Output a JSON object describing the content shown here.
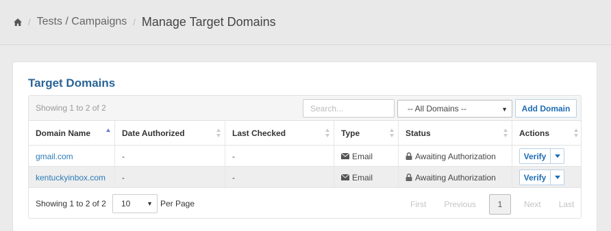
{
  "breadcrumb": {
    "home_icon": "home-icon",
    "items": [
      "Tests / Campaigns"
    ],
    "current": "Manage Target Domains"
  },
  "panel": {
    "title": "Target Domains"
  },
  "toolbar": {
    "info": "Showing 1 to 2 of 2",
    "search_placeholder": "Search...",
    "domain_filter": "-- All Domains --",
    "add_button": "Add Domain"
  },
  "table": {
    "columns": [
      "Domain Name",
      "Date Authorized",
      "Last Checked",
      "Type",
      "Status",
      "Actions"
    ],
    "sorted_column": "Domain Name",
    "rows": [
      {
        "domain": "gmail.com",
        "date_authorized": "-",
        "last_checked": "-",
        "type": "Email",
        "status": "Awaiting Authorization",
        "action": "Verify"
      },
      {
        "domain": "kentuckyinbox.com",
        "date_authorized": "-",
        "last_checked": "-",
        "type": "Email",
        "status": "Awaiting Authorization",
        "action": "Verify"
      }
    ]
  },
  "footer": {
    "info": "Showing 1 to 2 of 2",
    "per_page_value": "10",
    "per_page_label": "Per Page",
    "pagination": {
      "first": "First",
      "previous": "Previous",
      "current": "1",
      "next": "Next",
      "last": "Last"
    }
  },
  "colors": {
    "accent": "#1e6cb4",
    "title": "#2a6496",
    "link": "#2a7ab8",
    "sort_active": "#6c7bd6"
  }
}
